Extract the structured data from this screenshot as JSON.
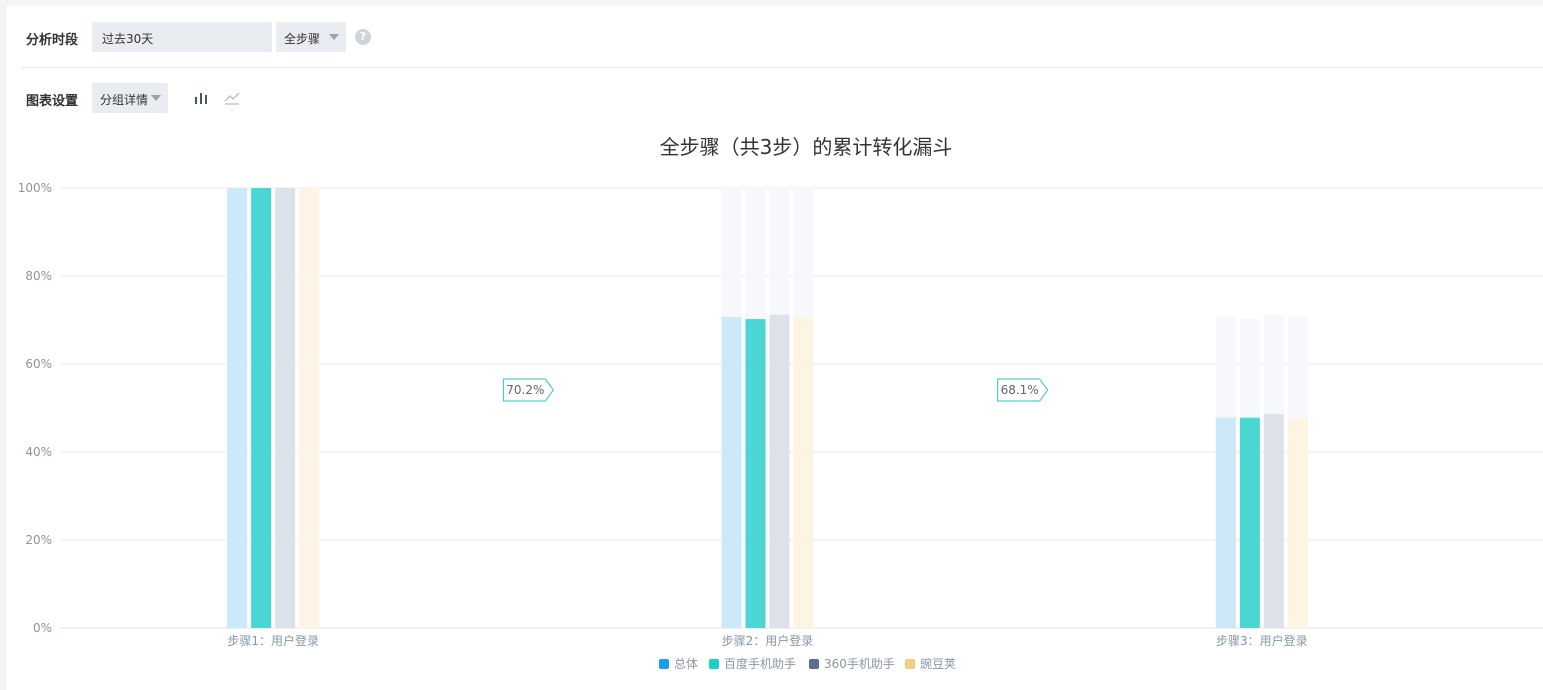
{
  "filters": {
    "period_label": "分析时段",
    "period_value": "过去30天",
    "steps_value": "全步骤",
    "help_glyph": "?"
  },
  "chart_settings": {
    "label": "图表设置",
    "group_value": "分组详情",
    "bar_icon": "bar-chart-icon",
    "line_icon": "line-chart-icon"
  },
  "colors": {
    "total": "#cce9f9",
    "baidu": "#4ad6d2",
    "c360": "#dde2ea",
    "wandoujia": "#fdf4e3",
    "ghost": "#f6f8fb",
    "legend_total": "#1a9cf0",
    "legend_baidu": "#1ccfc9",
    "legend_360": "#5c6e8f",
    "legend_wandoujia": "#f5cd80",
    "badge": "#2ec4be"
  },
  "chart_data": {
    "type": "bar",
    "title": "全步骤（共3步）的累计转化漏斗",
    "categories": [
      "步骤1：用户登录",
      "步骤2：用户登录",
      "步骤3：用户登录"
    ],
    "ylim": [
      0,
      100
    ],
    "yticks": [
      "0%",
      "20%",
      "40%",
      "60%",
      "80%",
      "100%"
    ],
    "ytick_values": [
      0,
      20,
      40,
      60,
      80,
      100
    ],
    "series": [
      {
        "name": "总体",
        "values": [
          100,
          70.7,
          47.8
        ]
      },
      {
        "name": "百度手机助手",
        "values": [
          100,
          70.2,
          47.8
        ]
      },
      {
        "name": "360手机助手",
        "values": [
          100,
          71.2,
          48.6
        ]
      },
      {
        "name": "豌豆荚",
        "values": [
          100,
          70.7,
          47.4
        ]
      }
    ],
    "conversion_badges": [
      "70.2%",
      "68.1%"
    ],
    "grid": true,
    "legend_position": "bottom-center"
  }
}
